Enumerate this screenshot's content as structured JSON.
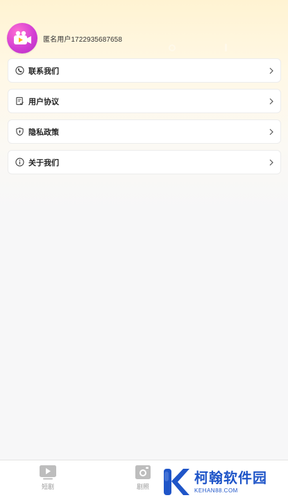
{
  "profile": {
    "username": "匿名用户1722935687658",
    "avatar_icon": "video-camera-icon"
  },
  "menu": {
    "items": [
      {
        "label": "联系我们",
        "icon": "phone-icon"
      },
      {
        "label": "用户协议",
        "icon": "agreement-icon"
      },
      {
        "label": "隐私政策",
        "icon": "shield-icon"
      },
      {
        "label": "关于我们",
        "icon": "info-icon"
      }
    ]
  },
  "tabbar": {
    "tabs": [
      {
        "label": "短剧",
        "icon": "play-icon"
      },
      {
        "label": "剧照",
        "icon": "camera-icon"
      }
    ]
  },
  "watermark": {
    "cn": "柯翰软件园",
    "en": "KEHAN88.COM"
  },
  "colors": {
    "accent_pink": "#d43fd4",
    "watermark_blue": "#1f55c8",
    "header_gradient": "#fff3d2"
  }
}
